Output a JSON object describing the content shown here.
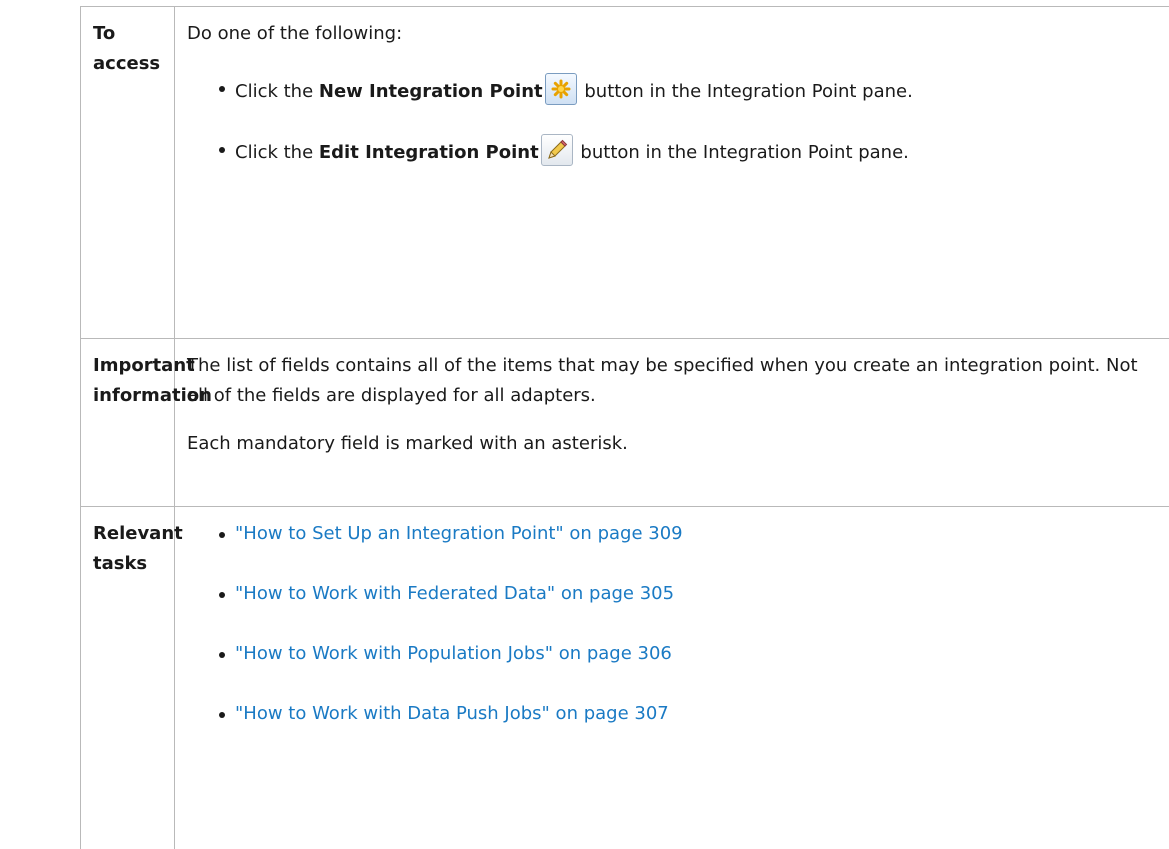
{
  "table": {
    "access": {
      "heading": "To access",
      "intro": "Do one of the following:",
      "items": [
        {
          "prefix": "Click the ",
          "bold": "New Integration Point",
          "icon": "new-integration-point-icon",
          "suffix": " button in the Integration Point pane."
        },
        {
          "prefix": "Click the ",
          "bold": "Edit Integration Point",
          "icon": "edit-pencil-icon",
          "suffix": " button in the Integration Point pane."
        }
      ]
    },
    "important": {
      "heading": "Important information",
      "para1": "The list of fields contains all of the items that may be specified when you create an integration point. Not all of the fields are displayed for all adapters.",
      "para2": "Each mandatory field is marked with an asterisk."
    },
    "tasks": {
      "heading": "Relevant tasks",
      "links": [
        "\"How to Set Up an Integration Point\" on page 309",
        "\"How to Work with Federated Data\" on page 305",
        "\"How to Work with Population Jobs\" on page 306",
        "\"How to Work with Data Push Jobs\" on page 307"
      ]
    }
  },
  "colors": {
    "link": "#1a7ac4",
    "border": "#b9b9b9",
    "text": "#1a1a1a"
  }
}
